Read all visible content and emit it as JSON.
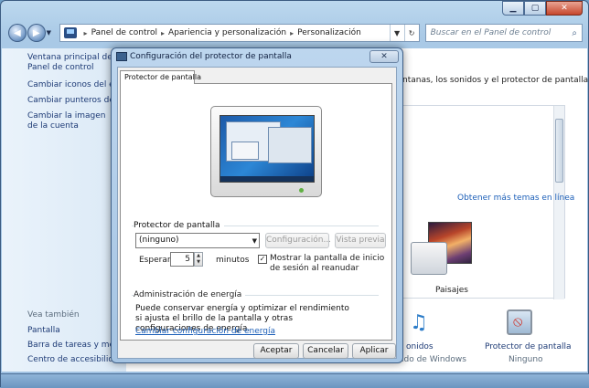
{
  "explorer": {
    "breadcrumb": [
      "Panel de control",
      "Apariencia y personalización",
      "Personalización"
    ],
    "search_placeholder": "Buscar en el Panel de control",
    "sidebar": {
      "items": [
        "Ventana principal del Panel de control",
        "Cambiar iconos del escritorio",
        "Cambiar punteros del mouse",
        "Cambiar la imagen de la cuenta"
      ],
      "see_also_heading": "Vea también",
      "see_also": [
        "Pantalla",
        "Barra de tareas y menú Inicio",
        "Centro de accesibilidad"
      ]
    },
    "main": {
      "description": "ntanas, los sonidos y el protector de pantalla al",
      "more_themes_link": "Obtener más temas en línea",
      "theme_name": "Paisajes",
      "sounds_label": "onidos",
      "sounds_sub": "ado de Windows",
      "screensaver_label": "Protector de pantalla",
      "screensaver_sub": "Ninguno"
    }
  },
  "dialog": {
    "title": "Configuración del protector de pantalla",
    "tab": "Protector de pantalla",
    "group_screensaver": {
      "title": "Protector de pantalla",
      "selected": "(ninguno)",
      "settings_button": "Configuración...",
      "preview_button": "Vista previa",
      "wait_label": "Esperar:",
      "wait_value": "5",
      "minutes_label": "minutos",
      "resume_checkbox_label": "Mostrar la pantalla de inicio de sesión al reanudar",
      "resume_checked": true
    },
    "group_power": {
      "title": "Administración de energía",
      "description": "Puede conservar energía y optimizar el rendimiento si ajusta el brillo de la pantalla y otras configuraciones de energía.",
      "link": "Cambiar configuración de energía"
    },
    "buttons": {
      "accept": "Aceptar",
      "cancel": "Cancelar",
      "apply": "Aplicar"
    }
  },
  "colors": {
    "link": "#1c5fb8",
    "frame": "#a9c9e6"
  }
}
